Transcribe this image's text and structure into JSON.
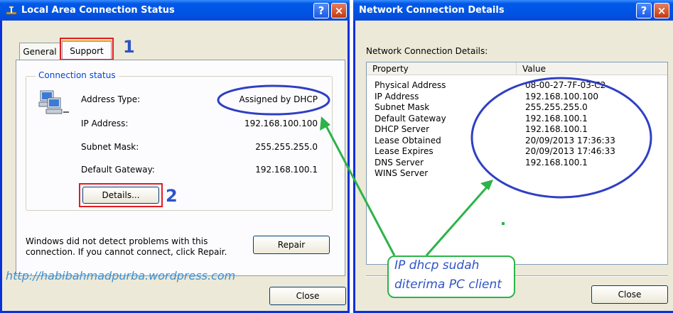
{
  "status_window": {
    "title": "Local Area Connection Status",
    "help_button": "?",
    "close_button": "×",
    "tabs": [
      "General",
      "Support"
    ],
    "group_title": "Connection status",
    "rows": [
      {
        "label": "Address Type:",
        "value": "Assigned by DHCP"
      },
      {
        "label": "IP Address:",
        "value": "192.168.100.100"
      },
      {
        "label": "Subnet Mask:",
        "value": "255.255.255.0"
      },
      {
        "label": "Default Gateway:",
        "value": "192.168.100.1"
      }
    ],
    "details_button": "Details...",
    "message": "Windows did not detect problems with this connection. If you cannot connect, click Repair.",
    "repair_button": "Repair",
    "close_dialog_button": "Close"
  },
  "details_window": {
    "title": "Network Connection Details",
    "help_button": "?",
    "close_button": "×",
    "caption": "Network Connection Details:",
    "columns": [
      "Property",
      "Value"
    ],
    "rows": [
      {
        "property": "Physical Address",
        "value": "08-00-27-7F-03-C2"
      },
      {
        "property": "IP Address",
        "value": "192.168.100.100"
      },
      {
        "property": "Subnet Mask",
        "value": "255.255.255.0"
      },
      {
        "property": "Default Gateway",
        "value": "192.168.100.1"
      },
      {
        "property": "DHCP Server",
        "value": "192.168.100.1"
      },
      {
        "property": "Lease Obtained",
        "value": "20/09/2013 17:36:33"
      },
      {
        "property": "Lease Expires",
        "value": "20/09/2013 17:46:33"
      },
      {
        "property": "DNS Server",
        "value": "192.168.100.1"
      },
      {
        "property": "WINS Server",
        "value": ""
      }
    ],
    "close_dialog_button": "Close"
  },
  "annotations": {
    "step1": "1",
    "step2": "2",
    "watermark": "http://habibahmadpurba.wordpress.com",
    "note_line1": "IP dhcp sudah",
    "note_line2": "diterima PC client",
    "colors": {
      "red": "#e31b23",
      "blue": "#2f3fc4",
      "green": "#2db34a",
      "title_blue": "#0054e3"
    }
  }
}
